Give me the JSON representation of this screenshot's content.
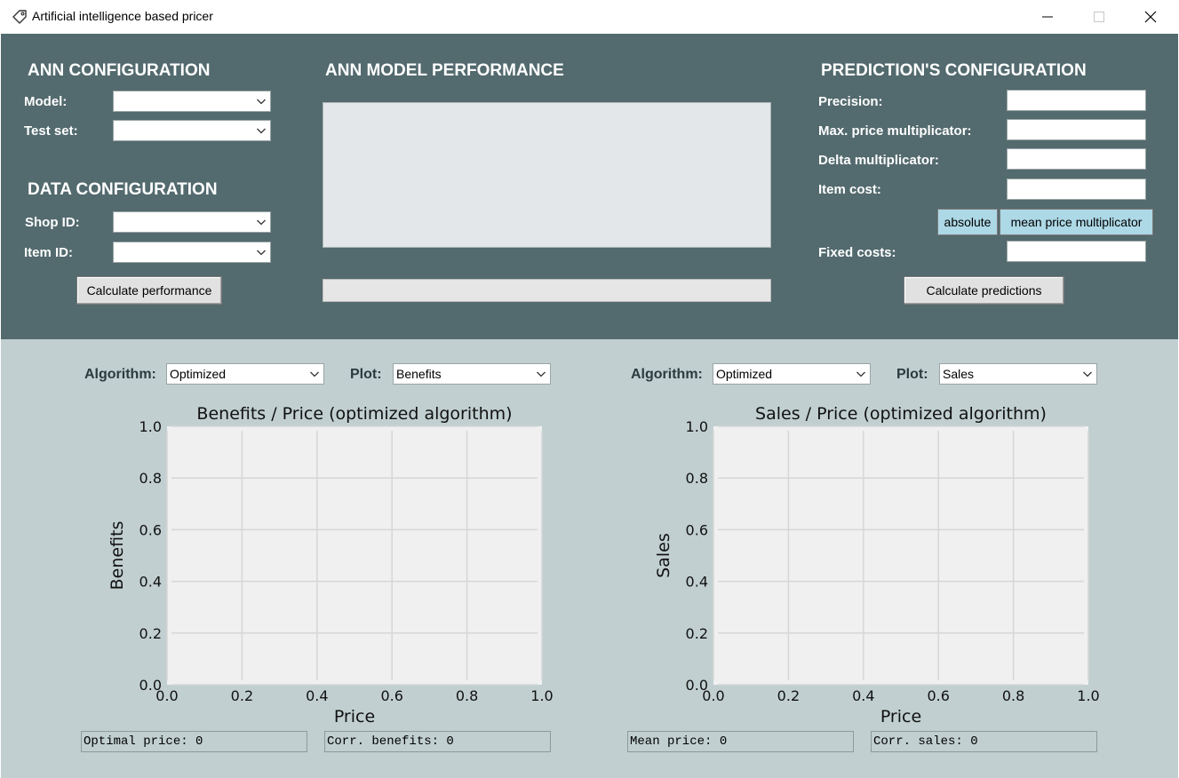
{
  "window": {
    "title": "Artificial intelligence based pricer"
  },
  "ann_config": {
    "title": "ANN CONFIGURATION",
    "model_label": "Model:",
    "model_value": "",
    "test_set_label": "Test set:",
    "test_set_value": ""
  },
  "data_config": {
    "title": "DATA CONFIGURATION",
    "shop_id_label": "Shop ID:",
    "shop_id_value": "",
    "item_id_label": "Item ID:",
    "item_id_value": "",
    "calculate_button": "Calculate performance"
  },
  "performance": {
    "title": "ANN MODEL PERFORMANCE"
  },
  "prediction_config": {
    "title": "PREDICTION'S CONFIGURATION",
    "precision_label": "Precision:",
    "max_price_label": "Max. price multiplicator:",
    "delta_label": "Delta multiplicator:",
    "item_cost_label": "Item cost:",
    "absolute_button": "absolute",
    "mean_price_button": "mean price multiplicator",
    "fixed_costs_label": "Fixed costs:",
    "calculate_button": "Calculate predictions"
  },
  "left_plot": {
    "algorithm_label": "Algorithm:",
    "algorithm_value": "Optimized",
    "plot_label": "Plot:",
    "plot_value": "Benefits",
    "readout_1": "Optimal price: 0",
    "readout_2": "Corr. benefits: 0"
  },
  "right_plot": {
    "algorithm_label": "Algorithm:",
    "algorithm_value": "Optimized",
    "plot_label": "Plot:",
    "plot_value": "Sales",
    "readout_1": "Mean price: 0",
    "readout_2": "Corr. sales: 0"
  },
  "colors": {
    "config_panel": "#536a6e",
    "plot_panel": "#c1cfd0",
    "plot_area": "#f0f0f0",
    "grid": "#d6d6d6",
    "button_accent": "#add8e6"
  },
  "chart_data": [
    {
      "type": "line",
      "title": "Benefits / Price (optimized algorithm)",
      "xlabel": "Price",
      "ylabel": "Benefits",
      "xlim": [
        0.0,
        1.0
      ],
      "ylim": [
        0.0,
        1.0
      ],
      "xticks": [
        "0.0",
        "0.2",
        "0.4",
        "0.6",
        "0.8",
        "1.0"
      ],
      "yticks": [
        "0.0",
        "0.2",
        "0.4",
        "0.6",
        "0.8",
        "1.0"
      ],
      "grid": true,
      "series": []
    },
    {
      "type": "line",
      "title": "Sales / Price (optimized algorithm)",
      "xlabel": "Price",
      "ylabel": "Sales",
      "xlim": [
        0.0,
        1.0
      ],
      "ylim": [
        0.0,
        1.0
      ],
      "xticks": [
        "0.0",
        "0.2",
        "0.4",
        "0.6",
        "0.8",
        "1.0"
      ],
      "yticks": [
        "0.0",
        "0.2",
        "0.4",
        "0.6",
        "0.8",
        "1.0"
      ],
      "grid": true,
      "series": []
    }
  ]
}
